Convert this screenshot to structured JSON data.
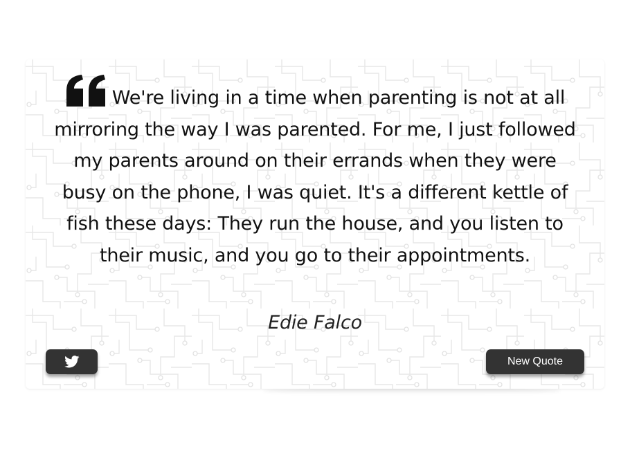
{
  "quote": {
    "text": "We're living in a time when parenting is not at all mirroring the way I was parented. For me, I just followed my parents around on their errands when they were busy on the phone, I was quiet. It's a different kettle of fish these days: They run the house, and you listen to their music, and you go to their appointments.",
    "author": "Edie Falco"
  },
  "buttons": {
    "twitter_icon": "twitter-bird",
    "new_quote_label": "New Quote"
  },
  "colors": {
    "button_bg": "#333333",
    "text": "#111111",
    "pattern": "#e6e6e6"
  }
}
